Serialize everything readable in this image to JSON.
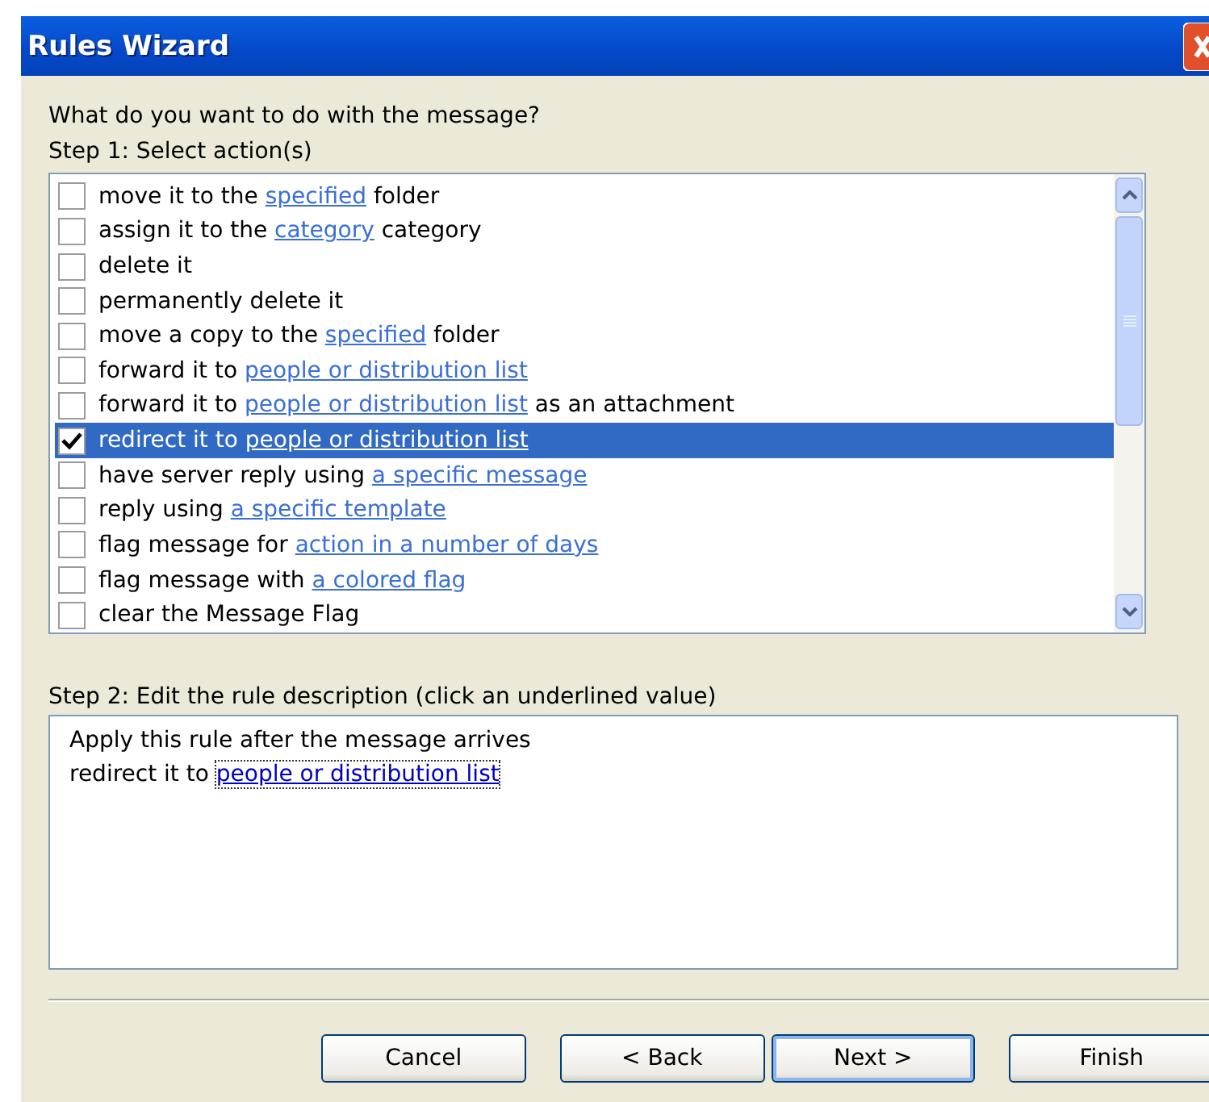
{
  "window": {
    "title": "Rules Wizard"
  },
  "question": "What do you want to do with the message?",
  "step1": {
    "label": "Step 1: Select action(s)",
    "actions": [
      {
        "checked": false,
        "selected": false,
        "parts": [
          {
            "text": "move it to the ",
            "link": false
          },
          {
            "text": "specified",
            "link": true
          },
          {
            "text": " folder",
            "link": false
          }
        ]
      },
      {
        "checked": false,
        "selected": false,
        "parts": [
          {
            "text": "assign it to the ",
            "link": false
          },
          {
            "text": "category",
            "link": true
          },
          {
            "text": " category",
            "link": false
          }
        ]
      },
      {
        "checked": false,
        "selected": false,
        "parts": [
          {
            "text": "delete it",
            "link": false
          }
        ]
      },
      {
        "checked": false,
        "selected": false,
        "parts": [
          {
            "text": "permanently delete it",
            "link": false
          }
        ]
      },
      {
        "checked": false,
        "selected": false,
        "parts": [
          {
            "text": "move a copy to the ",
            "link": false
          },
          {
            "text": "specified",
            "link": true
          },
          {
            "text": " folder",
            "link": false
          }
        ]
      },
      {
        "checked": false,
        "selected": false,
        "parts": [
          {
            "text": "forward it to ",
            "link": false
          },
          {
            "text": "people or distribution list",
            "link": true
          }
        ]
      },
      {
        "checked": false,
        "selected": false,
        "parts": [
          {
            "text": "forward it to ",
            "link": false
          },
          {
            "text": "people or distribution list",
            "link": true
          },
          {
            "text": " as an attachment",
            "link": false
          }
        ]
      },
      {
        "checked": true,
        "selected": true,
        "parts": [
          {
            "text": "redirect it to ",
            "link": false
          },
          {
            "text": "people or distribution list",
            "link": true
          }
        ]
      },
      {
        "checked": false,
        "selected": false,
        "parts": [
          {
            "text": "have server reply using ",
            "link": false
          },
          {
            "text": "a specific message",
            "link": true
          }
        ]
      },
      {
        "checked": false,
        "selected": false,
        "parts": [
          {
            "text": "reply using ",
            "link": false
          },
          {
            "text": "a specific template",
            "link": true
          }
        ]
      },
      {
        "checked": false,
        "selected": false,
        "parts": [
          {
            "text": "flag message for ",
            "link": false
          },
          {
            "text": "action in a number of days",
            "link": true
          }
        ]
      },
      {
        "checked": false,
        "selected": false,
        "parts": [
          {
            "text": "flag message with ",
            "link": false
          },
          {
            "text": "a colored flag",
            "link": true
          }
        ]
      },
      {
        "checked": false,
        "selected": false,
        "parts": [
          {
            "text": "clear the Message Flag",
            "link": false
          }
        ]
      }
    ]
  },
  "step2": {
    "label": "Step 2: Edit the rule description (click an underlined value)",
    "lines": [
      [
        {
          "text": "Apply this rule after the message arrives",
          "link": false
        }
      ],
      [
        {
          "text": "redirect it to ",
          "link": false
        },
        {
          "text": "people or distribution list",
          "link": true,
          "focused": true
        }
      ]
    ]
  },
  "buttons": [
    {
      "label": "Cancel",
      "default": false
    },
    {
      "label": "< Back",
      "default": false
    },
    {
      "label": "Next >",
      "default": true
    },
    {
      "label": "Finish",
      "default": false
    }
  ]
}
